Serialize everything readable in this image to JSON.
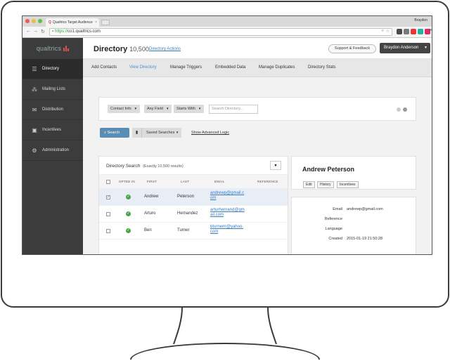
{
  "browser": {
    "tab_title": "Qualtrics Target Audience",
    "tab_favicon": "Q",
    "user": "Braydon",
    "url_scheme": "https://",
    "url_rest": "co1.qualtrics.com"
  },
  "app": {
    "logo": "qualtrics",
    "sidebar": [
      {
        "label": "Directory",
        "icon": "list-icon"
      },
      {
        "label": "Mailing Lists",
        "icon": "people-icon"
      },
      {
        "label": "Distribution",
        "icon": "envelope-icon"
      },
      {
        "label": "Incentives",
        "icon": "gift-icon"
      },
      {
        "label": "Administration",
        "icon": "gear-icon"
      }
    ],
    "header": {
      "title": "Directory",
      "count": "10,500",
      "actions_link": "Directory Actions",
      "support_button": "Support & Feedback",
      "user_button": "Braydon Anderson"
    },
    "subnav": [
      "Add Contacts",
      "View Directory",
      "Manage Triggers",
      "Embedded Data",
      "Manage Duplicates",
      "Directory Stats"
    ],
    "filters": {
      "field1": "Contact Info",
      "field2": "Any Field",
      "field3": "Starts With",
      "search_placeholder": "Search Directory..."
    },
    "search_button": "Search",
    "saved_searches": "Saved Searches",
    "advanced_logic": "Show Advanced Logic",
    "results": {
      "title": "Directory Search",
      "subtitle": "(Exactly 10,500 results)",
      "columns": [
        "OPTED IN",
        "FIRST",
        "LAST",
        "EMAIL",
        "REFERENCE"
      ],
      "rows": [
        {
          "first": "Andrew",
          "last": "Peterson",
          "email1": "andrewp@gmail.c",
          "email2": "om",
          "selected": true
        },
        {
          "first": "Arturo",
          "last": "Hernandez",
          "email1": "arturhernand@gm",
          "email2": "ail.com",
          "selected": false
        },
        {
          "first": "Ben",
          "last": "Turner",
          "email1": "bturnerrr@yahoo.",
          "email2": "com",
          "selected": false
        }
      ]
    },
    "profile": {
      "name": "Andrew Peterson",
      "buttons": [
        "Edit",
        "History",
        "Incentives"
      ],
      "fields": [
        {
          "label": "Email",
          "value": "andrewp@gmail.com"
        },
        {
          "label": "Reference",
          "value": ""
        },
        {
          "label": "Language",
          "value": ""
        },
        {
          "label": "Created",
          "value": "2015-01-19 21:50:28"
        }
      ]
    }
  }
}
